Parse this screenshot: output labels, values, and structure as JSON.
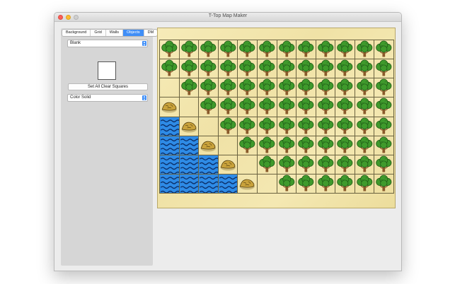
{
  "window": {
    "title": "T-Top Map Maker"
  },
  "tabs": [
    {
      "label": "Background",
      "active": false
    },
    {
      "label": "Grid",
      "active": false
    },
    {
      "label": "Walls",
      "active": false
    },
    {
      "label": "Objects",
      "active": true
    },
    {
      "label": "DM",
      "active": false
    }
  ],
  "objects_panel": {
    "object_select": "Blank",
    "clear_button": "Set All Clear Squares",
    "fill_select": "Color Solid"
  },
  "colors": {
    "accent": "#3f8ef7",
    "parchment": "#f3e6ad",
    "water": "#2e8be6",
    "tree_foliage": "#3f9a2c",
    "rock": "#c9a23b"
  },
  "map": {
    "columns": 12,
    "rows": 8,
    "legend": {
      "T": "tree-icon",
      "W": "water-icon",
      "R": "rock-icon",
      ".": "empty"
    },
    "cells": [
      "TTTTTTTTTTTT",
      "TTTTTTTTTTTT",
      ".TTTTTTTTTTT",
      "R.TTTTTTTTTT",
      "WR.TTTTTTTTT",
      "WWR.TTTTTTTT",
      "WWWR.TTTTTTT",
      "WWWWR.TTTTTT"
    ]
  }
}
